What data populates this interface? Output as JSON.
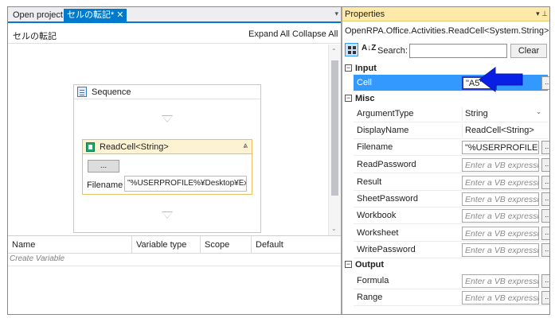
{
  "tabs": [
    {
      "label": "Open project"
    },
    {
      "label": "セルの転記*",
      "close": "✕"
    }
  ],
  "designer": {
    "breadcrumb": "セルの転記",
    "expand_all": "Expand All",
    "collapse_all": "Collapse All",
    "sequence": {
      "title": "Sequence"
    },
    "activity": {
      "title": "ReadCell<String>",
      "button_label": "...",
      "field_label": "Filename",
      "field_value": "\"%USERPROFILE%¥Desktop¥Exc"
    }
  },
  "variables": {
    "columns": [
      "Name",
      "Variable type",
      "Scope",
      "Default"
    ],
    "create_label": "Create Variable"
  },
  "properties": {
    "title": "Properties",
    "type_name": "OpenRPA.Office.Activities.ReadCell<System.String>",
    "search_label": "Search:",
    "clear_label": "Clear",
    "sort_label": "A↓Z",
    "categories": {
      "input": "Input",
      "misc": "Misc",
      "output": "Output"
    },
    "input": [
      {
        "name": "Cell",
        "value": "\"A5\""
      }
    ],
    "misc": [
      {
        "name": "ArgumentType",
        "value": "String"
      },
      {
        "name": "DisplayName",
        "value": "ReadCell<String>"
      },
      {
        "name": "Filename",
        "value": "\"%USERPROFILE%¥D"
      },
      {
        "name": "ReadPassword",
        "value": "Enter a VB expressio"
      },
      {
        "name": "Result",
        "value": "Enter a VB expressio"
      },
      {
        "name": "SheetPassword",
        "value": "Enter a VB expressio"
      },
      {
        "name": "Workbook",
        "value": "Enter a VB expressio"
      },
      {
        "name": "Worksheet",
        "value": "Enter a VB expressio"
      },
      {
        "name": "WritePassword",
        "value": "Enter a VB expressio"
      }
    ],
    "output": [
      {
        "name": "Formula",
        "value": "Enter a VB expressio"
      },
      {
        "name": "Range",
        "value": "Enter a VB expressio"
      }
    ]
  },
  "colors": {
    "accent": "#007acc",
    "selection": "#3399ff",
    "arrow": "#0a1fe6",
    "properties_header": "#ffe9a8",
    "activity_header": "#fdf3d3"
  },
  "icons": {
    "sequence": "sequence-icon",
    "activity": "excel-icon",
    "annotation": "arrow-left-icon"
  }
}
